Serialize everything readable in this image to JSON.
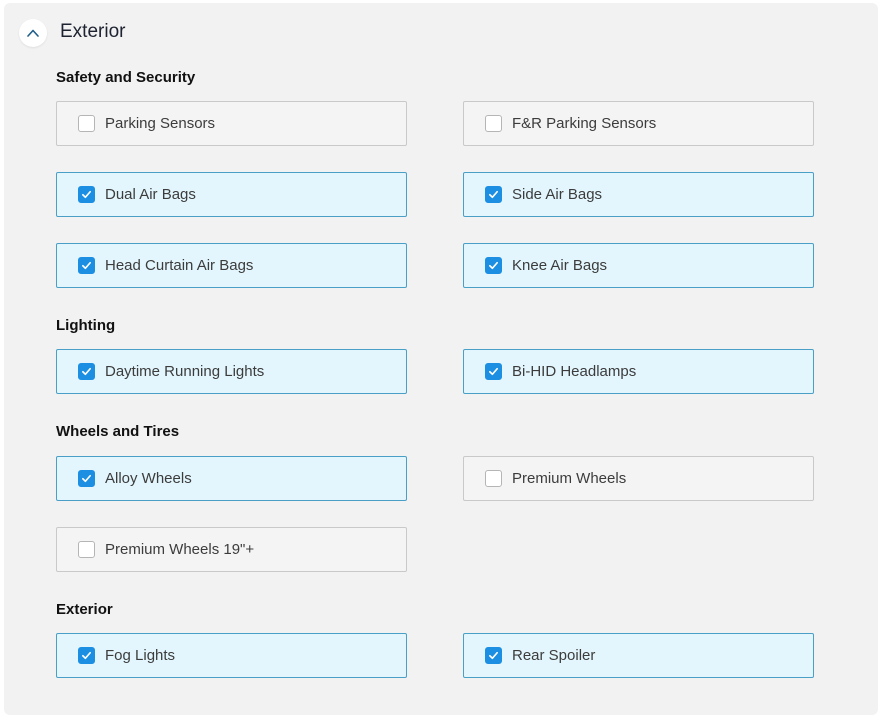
{
  "section": {
    "title": "Exterior",
    "expanded": true,
    "toggle_icon": "chevron-up-icon"
  },
  "colors": {
    "checked_bg": "#e3f6fd",
    "checked_border": "#4a9fc7",
    "checkbox_fill": "#1c8fe3"
  },
  "groups": [
    {
      "title": "Safety and Security",
      "options": [
        {
          "label": "Parking Sensors",
          "checked": false
        },
        {
          "label": "F&R Parking Sensors",
          "checked": false
        },
        {
          "label": "Dual Air Bags",
          "checked": true
        },
        {
          "label": "Side Air Bags",
          "checked": true
        },
        {
          "label": "Head Curtain Air Bags",
          "checked": true
        },
        {
          "label": "Knee Air Bags",
          "checked": true
        }
      ]
    },
    {
      "title": "Lighting",
      "options": [
        {
          "label": "Daytime Running Lights",
          "checked": true
        },
        {
          "label": "Bi-HID Headlamps",
          "checked": true
        }
      ]
    },
    {
      "title": "Wheels and Tires",
      "options": [
        {
          "label": "Alloy Wheels",
          "checked": true
        },
        {
          "label": "Premium Wheels",
          "checked": false
        },
        {
          "label": "Premium Wheels 19\"+",
          "checked": false
        }
      ]
    },
    {
      "title": "Exterior",
      "options": [
        {
          "label": "Fog Lights",
          "checked": true
        },
        {
          "label": "Rear Spoiler",
          "checked": true
        }
      ]
    }
  ]
}
